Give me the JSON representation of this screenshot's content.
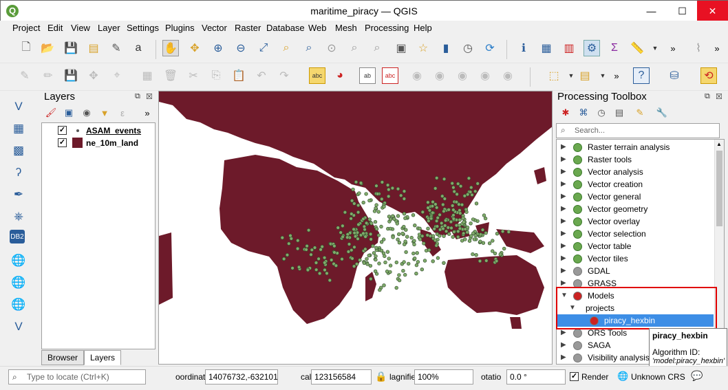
{
  "window": {
    "title": "maritime_piracy — QGIS",
    "minimize": "—",
    "maximize": "☐",
    "close": "✕"
  },
  "menu": [
    "Project",
    "Edit",
    "View",
    "Layer",
    "Settings",
    "Plugins",
    "Vector",
    "Raster",
    "Database",
    "Web",
    "Mesh",
    "Processing",
    "Help"
  ],
  "layers_panel": {
    "title": "Layers",
    "layers": [
      {
        "name": "ASAM_events",
        "checked": true,
        "symbol_color": "#555555"
      },
      {
        "name": "ne_10m_land",
        "checked": true,
        "symbol_color": "#6d1a2a"
      }
    ],
    "tabs": [
      "Browser",
      "Layers"
    ]
  },
  "map": {
    "land_color": "#6d1a2a",
    "point_color": "#7faa6a",
    "point_outline": "#2f4a2a",
    "background": "#ffffff"
  },
  "toolbox": {
    "title": "Processing Toolbox",
    "search_placeholder": "Search...",
    "items": [
      {
        "label": "Raster terrain analysis",
        "icon": "qgis-icon"
      },
      {
        "label": "Raster tools",
        "icon": "qgis-icon"
      },
      {
        "label": "Vector analysis",
        "icon": "qgis-icon"
      },
      {
        "label": "Vector creation",
        "icon": "qgis-icon"
      },
      {
        "label": "Vector general",
        "icon": "qgis-icon"
      },
      {
        "label": "Vector geometry",
        "icon": "qgis-icon"
      },
      {
        "label": "Vector overlay",
        "icon": "qgis-icon"
      },
      {
        "label": "Vector selection",
        "icon": "qgis-icon"
      },
      {
        "label": "Vector table",
        "icon": "qgis-icon"
      },
      {
        "label": "Vector tiles",
        "icon": "qgis-icon"
      },
      {
        "label": "GDAL",
        "icon": "gdal-icon"
      },
      {
        "label": "GRASS",
        "icon": "grass-icon"
      },
      {
        "label": "Models",
        "icon": "models-icon"
      },
      {
        "label": "projects",
        "icon": ""
      },
      {
        "label": "piracy_hexbin",
        "icon": "model-icon"
      },
      {
        "label": "ORS Tools",
        "icon": "ors-icon"
      },
      {
        "label": "SAGA",
        "icon": "saga-icon"
      },
      {
        "label": "Visibility analysis",
        "icon": "eye-icon"
      }
    ]
  },
  "tooltip": {
    "title": "piracy_hexbin",
    "line1": "Algorithm ID:",
    "line2": "'model:piracy_hexbin'"
  },
  "status": {
    "locate_placeholder": "Type to locate (Ctrl+K)",
    "coord_label": "oordinat",
    "coord_value": "14076732,-632101",
    "scale_label": "cal",
    "scale_value": "123156584",
    "magnifier_label": "lagnifie",
    "magnifier_value": "100%",
    "rotation_label": "otatio",
    "rotation_value": "0.0 °",
    "render_label": "Render",
    "crs_label": "Unknown CRS"
  }
}
